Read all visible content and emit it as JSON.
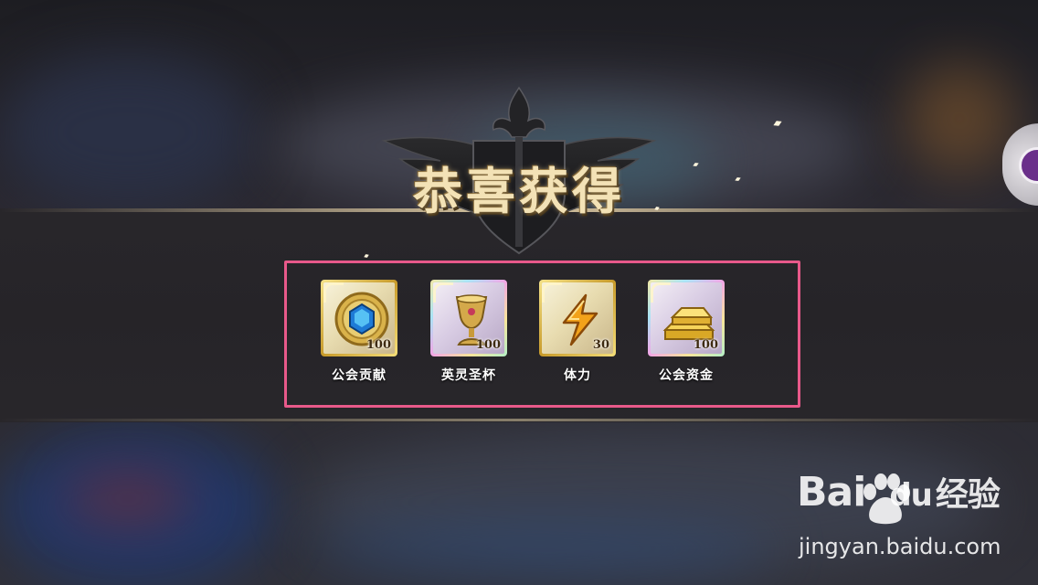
{
  "title": "恭喜获得",
  "rewards": [
    {
      "name": "公会贡献",
      "quantity": "100",
      "icon": "guild-contribution-coin-icon",
      "frame": "gold"
    },
    {
      "name": "英灵圣杯",
      "quantity": "100",
      "icon": "holy-grail-icon",
      "frame": "rainbow"
    },
    {
      "name": "体力",
      "quantity": "30",
      "icon": "stamina-lightning-icon",
      "frame": "gold"
    },
    {
      "name": "公会资金",
      "quantity": "100",
      "icon": "gold-bar-icon",
      "frame": "rainbow"
    }
  ],
  "highlight_color": "#e8598a",
  "watermark": {
    "brand_left": "Bai",
    "brand_mid": "du",
    "brand_right": "经验",
    "url": "jingyan.baidu.com"
  }
}
